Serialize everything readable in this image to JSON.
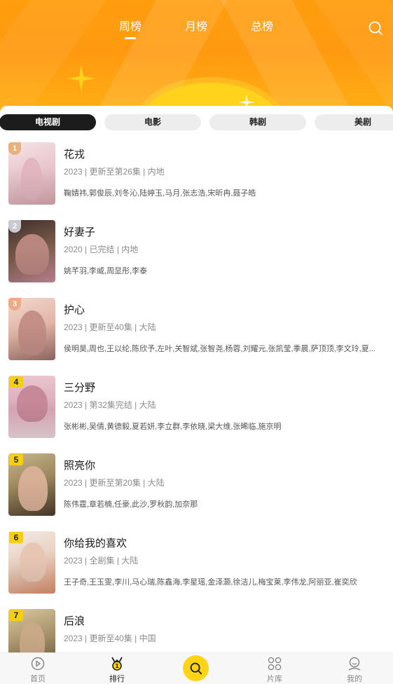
{
  "header": {
    "tabs": [
      {
        "label": "周榜",
        "active": true
      },
      {
        "label": "月榜",
        "active": false
      },
      {
        "label": "总榜",
        "active": false
      }
    ],
    "search_icon": "search-icon"
  },
  "categories": [
    "电视剧",
    "电影",
    "韩剧",
    "美剧"
  ],
  "ranking": [
    {
      "rank": "1",
      "title": "花戎",
      "meta": "2023 | 更新至第26集 | 内地",
      "cast": "鞠婧祎,郭俊辰,刘冬沁,陆婷玉,马月,张志浩,宋昕冉,聂子皓"
    },
    {
      "rank": "2",
      "title": "好妻子",
      "meta": "2020 | 已完结 | 内地",
      "cast": "姚芊羽,李威,周显彤,李泰"
    },
    {
      "rank": "3",
      "title": "护心",
      "meta": "2023 | 更新至40集 | 大陆",
      "cast": "侯明昊,周也,王以纶,陈欣予,左叶,关智斌,张智尧,杨蓉,刘耀元,张凯莹,季晨,萨顶顶,李文玲,夏..."
    },
    {
      "rank": "4",
      "title": "三分野",
      "meta": "2023 | 第32集完结 | 大陆",
      "cast": "张彬彬,吴倩,黄德毅,夏若妍,李立群,李依晓,梁大维,张晞临,施京明"
    },
    {
      "rank": "5",
      "title": "照亮你",
      "meta": "2023 | 更新至第20集 | 大陆",
      "cast": "陈伟霆,章若楠,任豪,此沙,罗秋韵,加奈那"
    },
    {
      "rank": "6",
      "title": "你给我的喜欢",
      "meta": "2023 | 全剧集 | 大陆",
      "cast": "王子奇,王玉雯,李川,马心瑞,陈鑫海,李星瑶,金泽灏,徐洁儿,梅宝莱,李伟龙,阿丽亚,崔奕欣"
    },
    {
      "rank": "7",
      "title": "后浪",
      "meta": "2023 | 更新至40集 | 中国",
      "cast": ""
    }
  ],
  "bottom_nav": [
    {
      "label": "首页",
      "icon": "home-play-icon",
      "active": false
    },
    {
      "label": "排行",
      "icon": "rank-medal-icon",
      "active": true
    },
    {
      "label": "",
      "icon": "search-icon",
      "active": false
    },
    {
      "label": "片库",
      "icon": "grid-library-icon",
      "active": false
    },
    {
      "label": "我的",
      "icon": "profile-icon",
      "active": false
    }
  ],
  "colors": {
    "header_orange": "#ff9d0e",
    "accent_yellow": "#ffd414",
    "active_chip": "#1c1c1c",
    "rank_gold": "#e8b07a",
    "rank_silver": "#c9c9d2",
    "rank_bronze": "#f0a987"
  }
}
